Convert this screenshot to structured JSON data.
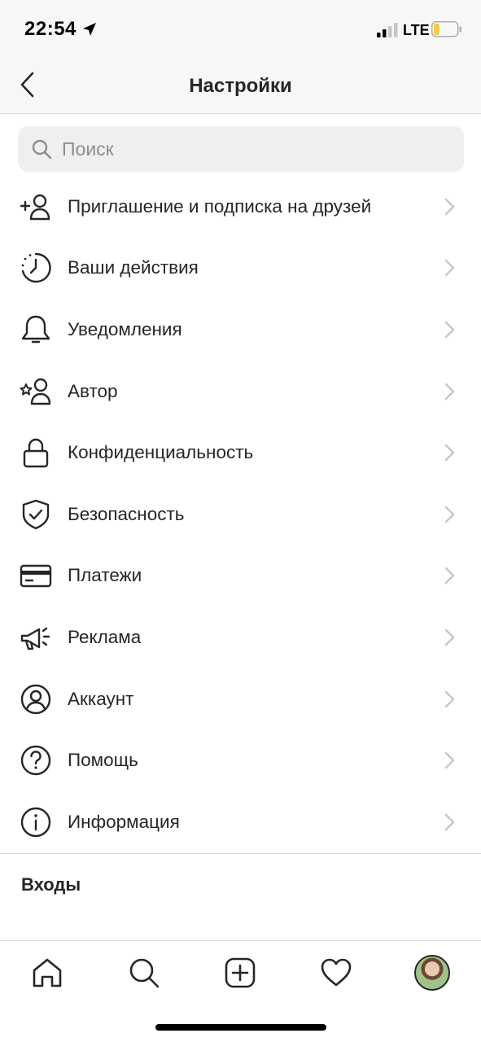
{
  "status_bar": {
    "time": "22:54",
    "network": "LTE",
    "battery_level": 0.25,
    "battery_color": "#f5cc3f"
  },
  "nav": {
    "title": "Настройки",
    "back_icon": "chevron-left-icon"
  },
  "search": {
    "placeholder": "Поиск"
  },
  "menu": {
    "items": [
      {
        "label": "Приглашение и подписка на друзей",
        "icon": "add-person-icon"
      },
      {
        "label": "Ваши действия",
        "icon": "activity-clock-icon"
      },
      {
        "label": "Уведомления",
        "icon": "bell-icon"
      },
      {
        "label": "Автор",
        "icon": "creator-star-person-icon"
      },
      {
        "label": "Конфиденциальность",
        "icon": "lock-icon"
      },
      {
        "label": "Безопасность",
        "icon": "shield-check-icon"
      },
      {
        "label": "Платежи",
        "icon": "credit-card-icon"
      },
      {
        "label": "Реклама",
        "icon": "megaphone-icon"
      },
      {
        "label": "Аккаунт",
        "icon": "account-circle-icon"
      },
      {
        "label": "Помощь",
        "icon": "help-circle-icon"
      },
      {
        "label": "Информация",
        "icon": "info-circle-icon"
      }
    ]
  },
  "section": {
    "title": "Входы"
  },
  "tab_bar": {
    "tabs": [
      "home-icon",
      "search-icon",
      "new-post-icon",
      "heart-icon",
      "profile-avatar"
    ]
  },
  "colors": {
    "text": "#262626",
    "chevron": "#c7c7c7",
    "divider": "#dbdbdb",
    "search_bg": "#efefef",
    "bar_bg": "#f7f7f7"
  }
}
